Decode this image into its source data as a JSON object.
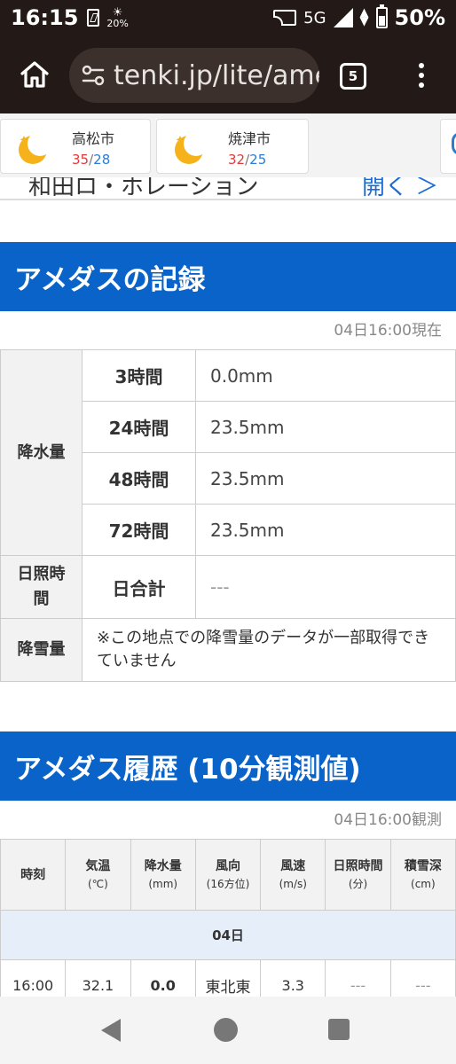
{
  "status": {
    "time": "16:15",
    "weather_pct": "20%",
    "network": "5G",
    "battery": "50%"
  },
  "browser": {
    "url": "tenki.jp/lite/amedas",
    "tab_count": "5"
  },
  "cities": [
    {
      "name": "高松市",
      "high": "35",
      "low": "28"
    },
    {
      "name": "焼津市",
      "high": "32",
      "low": "25"
    }
  ],
  "prev_row": {
    "text": "和田ロ・ホレーション",
    "link": "開く ＞"
  },
  "record": {
    "title": "アメダスの記録",
    "timestamp": "04日16:00現在",
    "precip_label": "降水量",
    "rows": [
      {
        "period": "3時間",
        "value": "0.0mm"
      },
      {
        "period": "24時間",
        "value": "23.5mm"
      },
      {
        "period": "48時間",
        "value": "23.5mm"
      },
      {
        "period": "72時間",
        "value": "23.5mm"
      }
    ],
    "sunshine_label": "日照時間",
    "sunshine_period": "日合計",
    "sunshine_value": "---",
    "snow_label": "降雪量",
    "snow_note": "※この地点での降雪量のデータが一部取得できていません"
  },
  "history": {
    "title": "アメダス履歴 (10分観測値)",
    "timestamp": "04日16:00観測",
    "headers": [
      {
        "label": "時刻",
        "unit": ""
      },
      {
        "label": "気温",
        "unit": "(℃)"
      },
      {
        "label": "降水量",
        "unit": "(mm)"
      },
      {
        "label": "風向",
        "unit": "(16方位)"
      },
      {
        "label": "風速",
        "unit": "(m/s)"
      },
      {
        "label": "日照時間",
        "unit": "(分)"
      },
      {
        "label": "積雪深",
        "unit": "(cm)"
      }
    ],
    "day": "04日",
    "rows": [
      {
        "time": "16:00",
        "temp": "32.1",
        "precip": "0.0",
        "wind_dir": "東北東",
        "wind_speed": "3.3",
        "sunshine": "---",
        "snow": "---"
      }
    ]
  }
}
